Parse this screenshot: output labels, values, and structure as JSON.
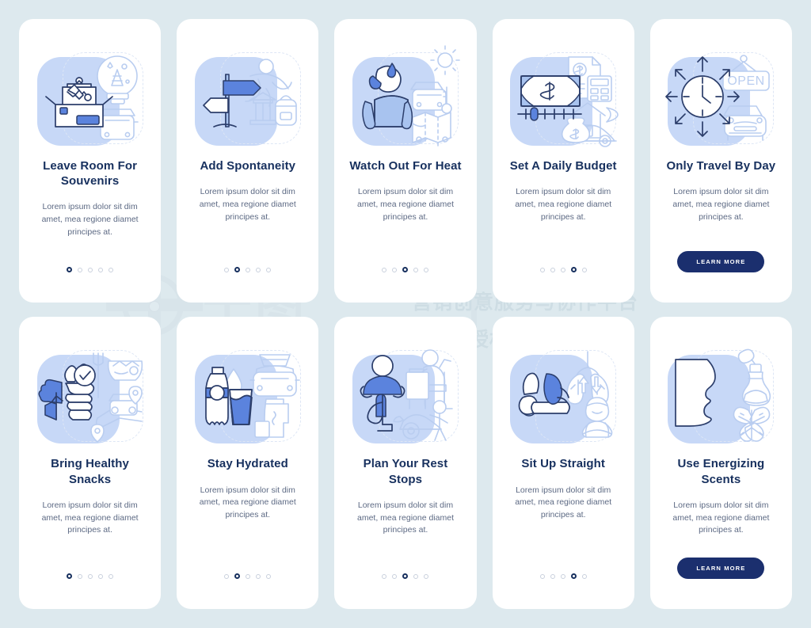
{
  "meta": {
    "background_color": "#dde9ee",
    "card_color": "#ffffff",
    "title_color": "#17305e",
    "body_color": "#5d6a84",
    "accent_color": "#5b83dd",
    "button_color": "#1b2f6e",
    "illustration_blob_color": "#c7d8f7"
  },
  "watermark": {
    "logo_text": "千图",
    "tagline": "营销创意服务与协作平台",
    "notice": "商用请获取授权"
  },
  "common": {
    "body_text": "Lorem ipsum dolor sit dim amet, mea regione diamet principes at.",
    "dot_count": 5,
    "cta_label": "LEARN MORE"
  },
  "cards": [
    {
      "id": "leave-room-for-souvenirs",
      "title": "Leave Room For Souvenirs",
      "body": "Lorem ipsum dolor sit dim amet, mea regione diamet principes at.",
      "footer_type": "dots",
      "active_dot": 1,
      "illustration": "souvenir-box-snowglobe-car-icon"
    },
    {
      "id": "add-spontaneity",
      "title": "Add Spontaneity",
      "body": "Lorem ipsum dolor sit dim amet, mea regione diamet principes at.",
      "footer_type": "dots",
      "active_dot": 2,
      "illustration": "signpost-jumping-person-temple-backpack-icon"
    },
    {
      "id": "watch-out-for-heat",
      "title": "Watch Out For Heat",
      "body": "Lorem ipsum dolor sit dim amet, mea regione diamet principes at.",
      "footer_type": "dots",
      "active_dot": 3,
      "illustration": "sweating-person-sun-car-map-icon"
    },
    {
      "id": "set-a-daily-budget",
      "title": "Set A Daily Budget",
      "body": "Lorem ipsum dolor sit dim amet, mea regione diamet principes at.",
      "footer_type": "dots",
      "active_dot": 4,
      "illustration": "banknote-invoice-house-moneybag-car-icon"
    },
    {
      "id": "only-travel-by-day",
      "title": "Only Travel By Day",
      "body": "Lorem ipsum dolor sit dim amet, mea regione diamet principes at.",
      "footer_type": "button",
      "cta_label": "LEARN MORE",
      "illustration": "sun-clock-open-sign-car-icon"
    },
    {
      "id": "bring-healthy-snacks",
      "title": "Bring Healthy Snacks",
      "body": "Lorem ipsum dolor sit dim amet, mea regione diamet principes at.",
      "footer_type": "dots",
      "active_dot": 1,
      "illustration": "broccoli-stomach-salad-route-pins-icon"
    },
    {
      "id": "stay-hydrated",
      "title": "Stay Hydrated",
      "body": "Lorem ipsum dolor sit dim amet, mea regione diamet principes at.",
      "footer_type": "dots",
      "active_dot": 2,
      "illustration": "water-bottle-glass-thermos-car-icon"
    },
    {
      "id": "plan-your-rest-stops",
      "title": "Plan Your Rest Stops",
      "body": "Lorem ipsum dolor sit dim amet, mea regione diamet principes at.",
      "footer_type": "dots",
      "active_dot": 3,
      "illustration": "yoga-pose-cafe-walking-person-car-icon"
    },
    {
      "id": "sit-up-straight",
      "title": "Sit Up Straight",
      "body": "Lorem ipsum dolor sit dim amet, mea regione diamet principes at.",
      "footer_type": "dots",
      "active_dot": 4,
      "illustration": "spine-posture-lungs-driver-icon"
    },
    {
      "id": "use-energizing-scents",
      "title": "Use Energizing Scents",
      "body": "Lorem ipsum dolor sit dim amet, mea regione diamet principes at.",
      "footer_type": "button",
      "cta_label": "LEARN MORE",
      "illustration": "face-profile-perfume-bottle-mint-leaves-icon"
    }
  ]
}
